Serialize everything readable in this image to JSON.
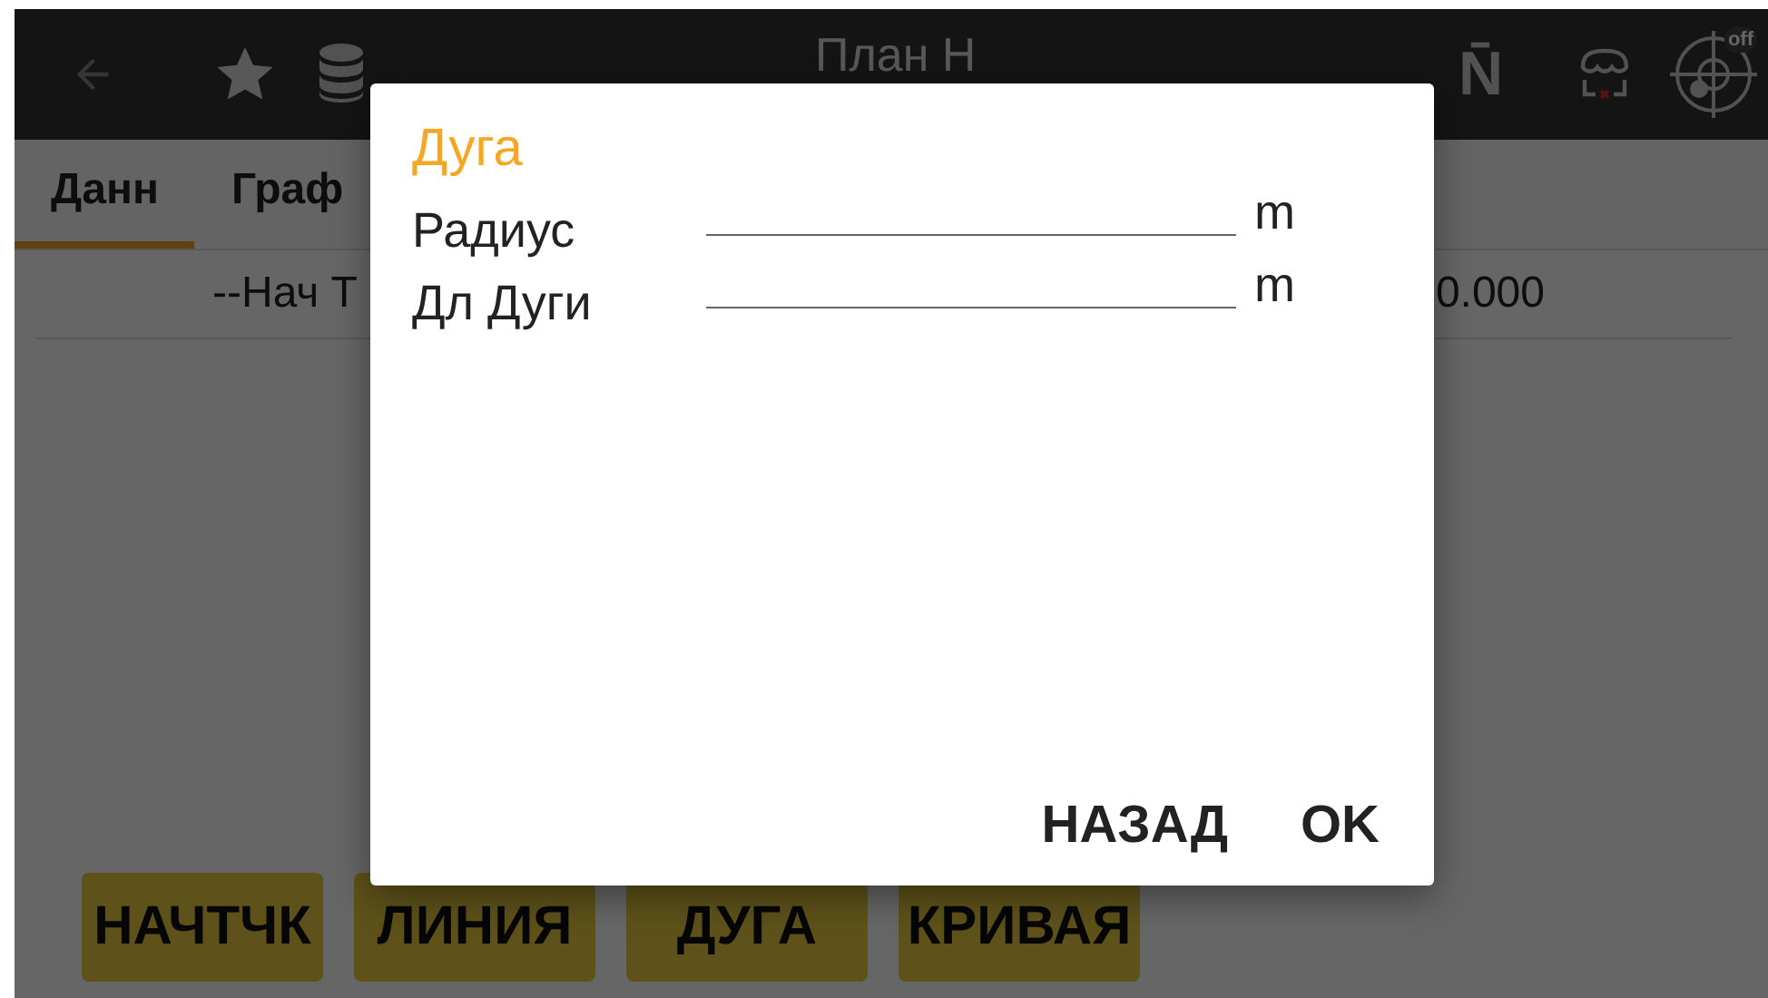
{
  "app_bar": {
    "title": "План Н",
    "north_label": "N̄",
    "gps_badge": "off"
  },
  "tabs": [
    {
      "label": "Данн",
      "selected": true
    },
    {
      "label": "Граф",
      "selected": false
    }
  ],
  "list_row": {
    "label": "--Нач Т",
    "value": "0.000"
  },
  "action_buttons": [
    "НАЧТЧК",
    "ЛИНИЯ",
    "ДУГА",
    "КРИВАЯ"
  ],
  "dialog": {
    "title": "Дуга",
    "fields": [
      {
        "label": "Радиус",
        "unit": "m"
      },
      {
        "label": "Дл Дуги",
        "unit": "m"
      }
    ],
    "buttons": [
      "НАЗАД",
      "OK"
    ]
  }
}
